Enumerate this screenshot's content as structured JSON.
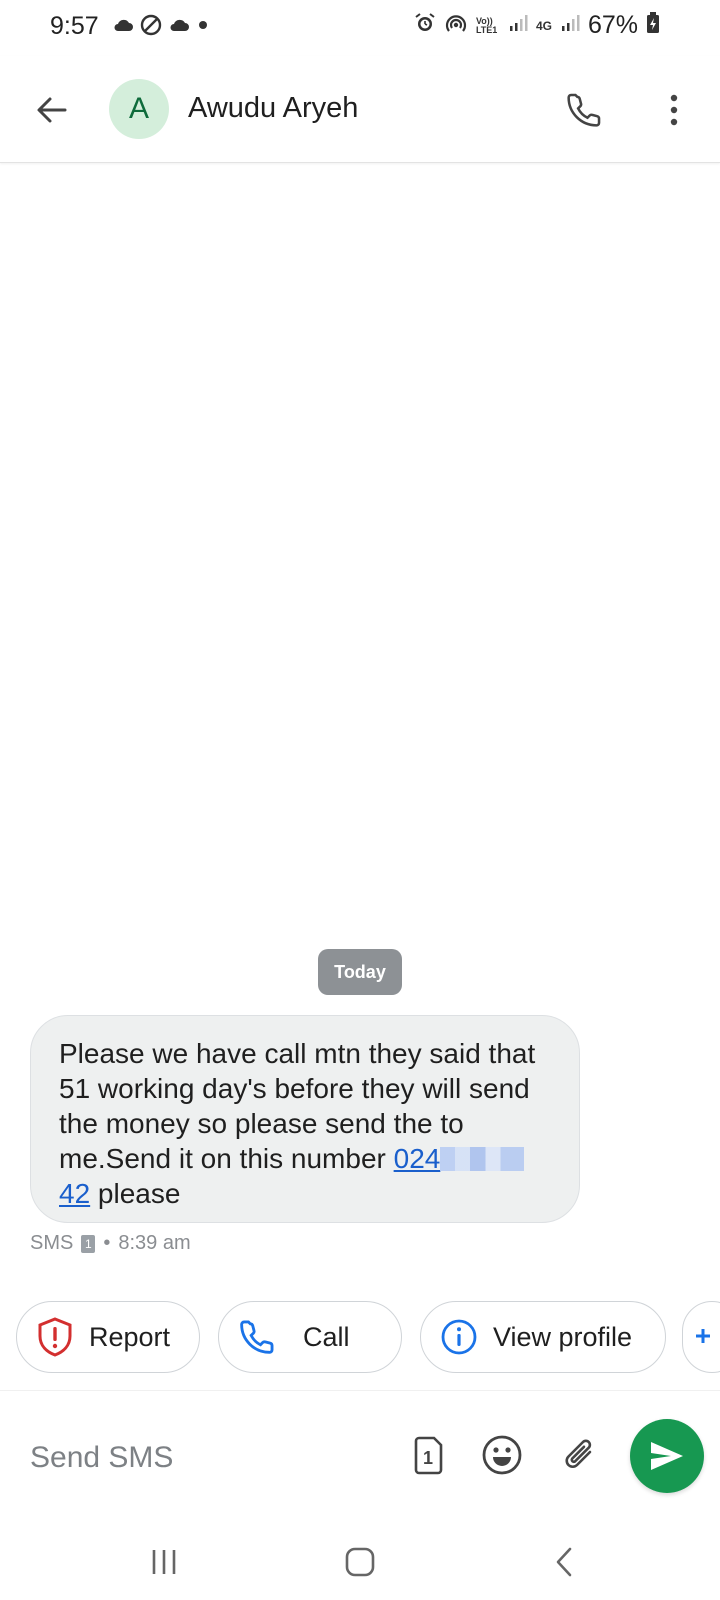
{
  "status_bar": {
    "time": "9:57",
    "battery": "67%",
    "icons_left": [
      "cloud-icon",
      "do-not-disturb-icon",
      "cloud-icon",
      "dot-icon"
    ],
    "icons_right": [
      "alarm-icon",
      "hotspot-icon",
      "volte-icon",
      "signal-icon",
      "4g-icon",
      "signal-icon",
      "battery-icon"
    ],
    "volte_label": "Vo)) LTE1",
    "network_label": "4G"
  },
  "header": {
    "avatar_letter": "A",
    "contact_name": "Awudu Aryeh",
    "colors": {
      "avatar_bg": "#d4eedb",
      "avatar_fg": "#0e6b3b"
    }
  },
  "conversation": {
    "date_chip": "Today",
    "message": {
      "text_before_link": "Please we have call mtn they said that 51 working day's before they will send the money so please send the to me.Send it on this number ",
      "link_prefix": "024",
      "link_suffix": "42",
      "text_after_link": " please"
    },
    "meta": {
      "channel": "SMS",
      "sim": "1",
      "separator": "•",
      "time": "8:39 am"
    }
  },
  "suggestions": [
    {
      "label": "Report",
      "icon": "shield-alert-icon"
    },
    {
      "label": "Call",
      "icon": "phone-icon"
    },
    {
      "label": "View profile",
      "icon": "info-icon"
    }
  ],
  "composer": {
    "placeholder": "Send SMS",
    "sim_label": "1",
    "colors": {
      "send_button": "#179851"
    }
  },
  "colors": {
    "accent_link": "#1a5fcc",
    "report_red": "#d32f2f",
    "call_blue": "#1a73e8"
  }
}
